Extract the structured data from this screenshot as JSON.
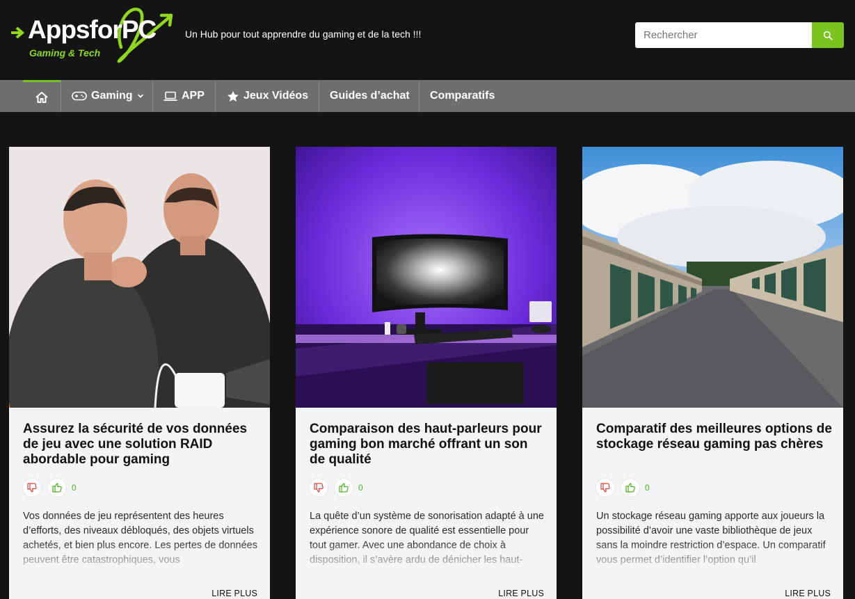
{
  "header": {
    "logo_text": "AppsforPC",
    "logo_sub": "Gaming & Tech",
    "tagline": "Un Hub pour tout apprendre du gaming et de la tech !!!",
    "accent_color": "#79c41f"
  },
  "search": {
    "placeholder": "Rechercher",
    "button_icon": "search-icon"
  },
  "nav": {
    "home_icon": "home-icon",
    "items": [
      {
        "label": "Gaming",
        "icon": "gamepad-icon",
        "has_dropdown": true
      },
      {
        "label": "APP",
        "icon": "laptop-icon"
      },
      {
        "label": "Jeux Vidéos",
        "icon": "star-icon"
      },
      {
        "label": "Guides d’achat"
      },
      {
        "label": "Comparatifs"
      }
    ]
  },
  "cards": [
    {
      "title": "Assurez la sécurité de vos données de jeu avec une solution RAID abordable pour gaming",
      "dislike_icon": "thumbs-down-icon",
      "like_icon": "thumbs-up-icon",
      "likes": "0",
      "excerpt": "Vos données de jeu représentent des heures d’efforts, des niveaux débloqués, des objets virtuels achetés, et bien plus encore. Les pertes de données peuvent être catastrophiques, vous",
      "read_more": "LIRE PLUS"
    },
    {
      "title": "Comparaison des haut-parleurs pour gaming bon marché offrant un son de qualité",
      "dislike_icon": "thumbs-down-icon",
      "like_icon": "thumbs-up-icon",
      "likes": "0",
      "excerpt": "La quête d’un système de sonorisation adapté à une expérience sonore de qualité est essentielle pour tout gamer. Avec une abondance de choix à disposition, il s’avère ardu de dénicher les haut-",
      "read_more": "LIRE PLUS"
    },
    {
      "title": "Comparatif des meilleures options de stockage réseau gaming pas chères",
      "dislike_icon": "thumbs-down-icon",
      "like_icon": "thumbs-up-icon",
      "likes": "0",
      "excerpt": "Un stockage réseau gaming apporte aux joueurs la possibilité d’avoir une vaste bibliothèque de jeux sans la moindre restriction d’espace. Un comparatif vous permet d’identifier l’option qu’il",
      "read_more": "LIRE PLUS"
    }
  ]
}
